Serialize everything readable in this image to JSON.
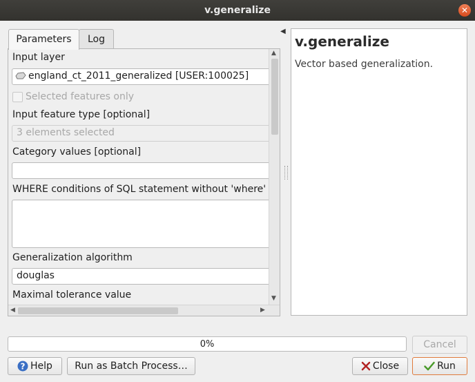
{
  "window": {
    "title": "v.generalize"
  },
  "tabs": [
    {
      "label": "Parameters"
    },
    {
      "label": "Log"
    }
  ],
  "params": {
    "input_layer_label": "Input layer",
    "input_layer_value": "england_ct_2011_generalized [USER:100025]",
    "selected_only_label": "Selected features only",
    "feature_type_label": "Input feature type [optional]",
    "feature_type_value": "3 elements selected",
    "category_label": "Category values [optional]",
    "category_value": "",
    "where_label": "WHERE conditions of SQL statement without 'where' keyword",
    "where_value": "",
    "algorithm_label": "Generalization algorithm",
    "algorithm_value": "douglas",
    "tolerance_label": "Maximal tolerance value"
  },
  "help": {
    "title": "v.generalize",
    "description": "Vector based generalization."
  },
  "progress": {
    "text": "0%",
    "value": 0
  },
  "buttons": {
    "cancel": "Cancel",
    "help": "Help",
    "batch": "Run as Batch Process…",
    "close": "Close",
    "run": "Run"
  },
  "icons": {
    "layer": "polygon-layer-icon",
    "help": "help-icon",
    "close": "close-x-icon",
    "run": "checkmark-icon"
  },
  "colors": {
    "titlebar": "#3c3b37",
    "close_button": "#e0582a",
    "help_icon": "#3a6fc4",
    "close_icon": "#b22222",
    "run_icon": "#4a9a2a",
    "default_border": "#e07b3c"
  }
}
